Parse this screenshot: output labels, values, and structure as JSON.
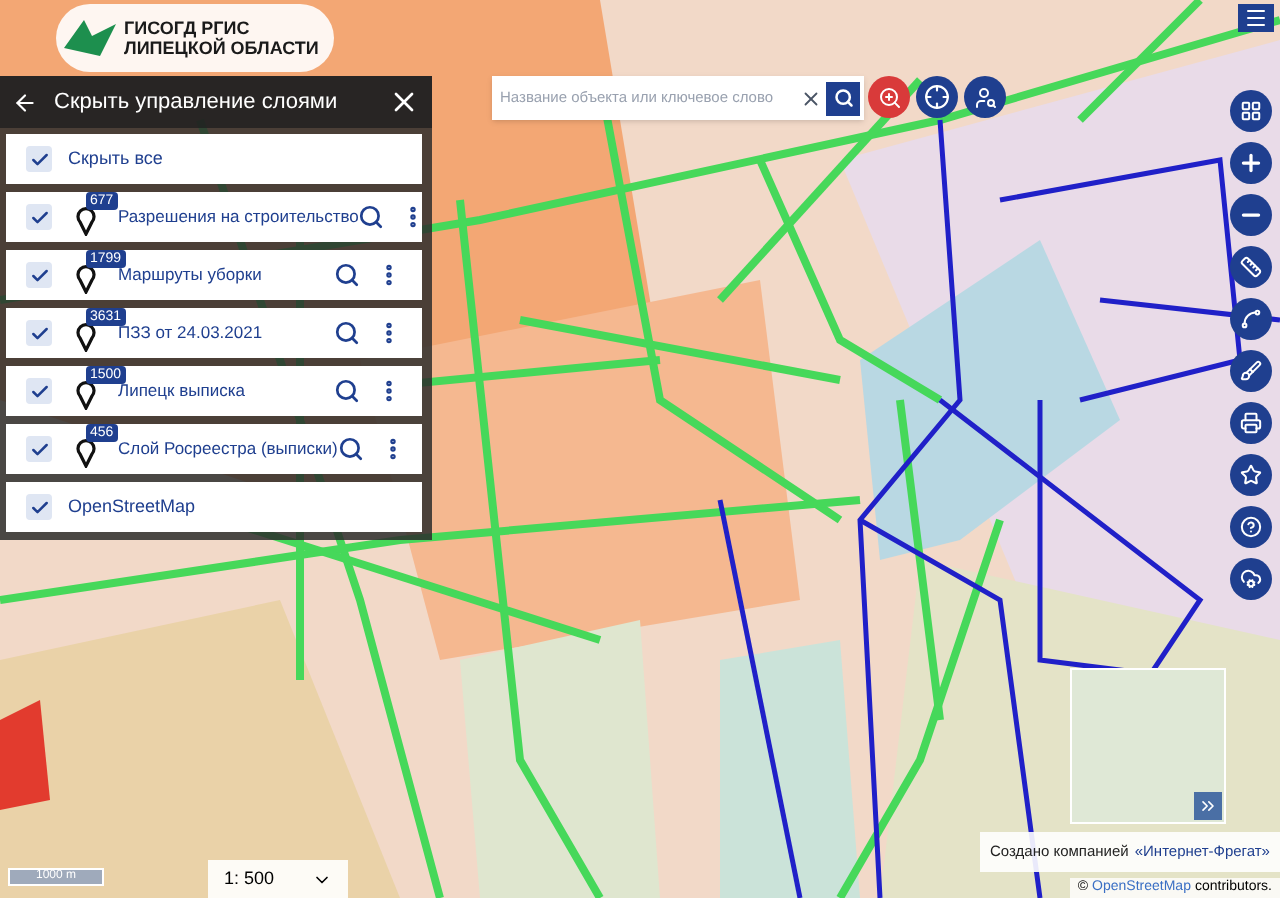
{
  "logo": {
    "line_1": "ГИСОГД РГИС",
    "line_2": "ЛИПЕЦКОЙ ОБЛАСТИ"
  },
  "layer_panel": {
    "title": "Скрыть управление слоями",
    "hide_all": {
      "label": "Скрыть все",
      "checked": true
    },
    "layers": [
      {
        "name": "Разрешения на строительство",
        "count": "677",
        "checked": true
      },
      {
        "name": "Маршруты уборки",
        "count": "1799",
        "checked": true
      },
      {
        "name": "ПЗЗ от 24.03.2021",
        "count": "3631",
        "checked": true
      },
      {
        "name": "Липецк выписка",
        "count": "1500",
        "checked": true
      },
      {
        "name": "Слой Росреестра (выписки)",
        "count": "456",
        "checked": true
      }
    ],
    "base_layer": {
      "label": "OpenStreetMap",
      "checked": true
    }
  },
  "search": {
    "placeholder": "Название объекта или ключевое слово"
  },
  "scale_bar": "1000 m",
  "scale_select": {
    "value": "1: 500"
  },
  "credit": {
    "text": "Создано компанией",
    "link": "«Интернет-Фрегат»"
  },
  "attribution": {
    "symbol": "©",
    "link": "OpenStreetMap",
    "text": "contributors."
  }
}
